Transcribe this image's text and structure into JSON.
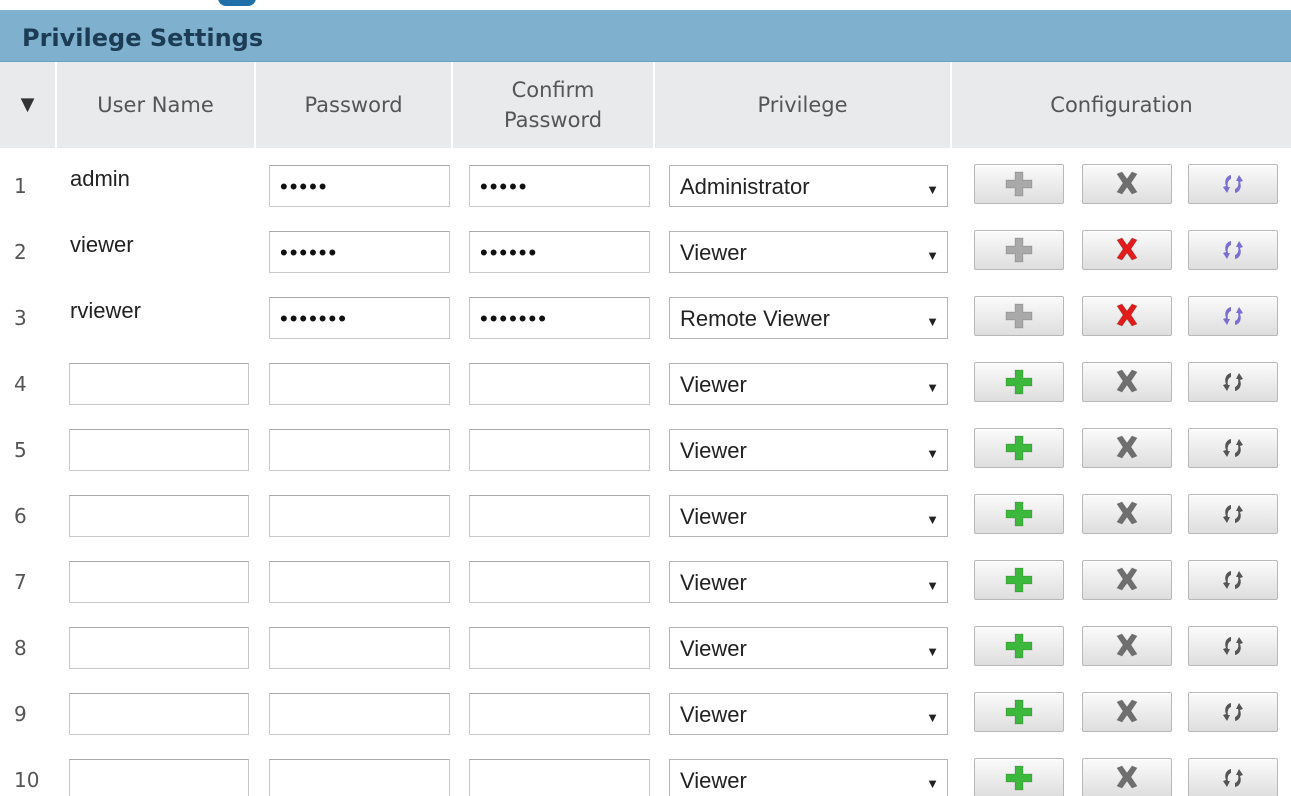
{
  "panel": {
    "title": "Privilege Settings"
  },
  "columns": {
    "sort_indicator": "▼",
    "user_name": "User Name",
    "password": "Password",
    "confirm_password_line1": "Confirm",
    "confirm_password_line2": "Password",
    "privilege": "Privilege",
    "configuration": "Configuration"
  },
  "rows": [
    {
      "num": "1",
      "user": "admin",
      "password": "•••••",
      "confirm": "•••••",
      "privilege": "Administrator",
      "existing": true,
      "delete_enabled": false
    },
    {
      "num": "2",
      "user": "viewer",
      "password": "••••••",
      "confirm": "••••••",
      "privilege": "Viewer",
      "existing": true,
      "delete_enabled": true
    },
    {
      "num": "3",
      "user": "rviewer",
      "password": "•••••••",
      "confirm": "•••••••",
      "privilege": "Remote Viewer",
      "existing": true,
      "delete_enabled": true
    },
    {
      "num": "4",
      "user": "",
      "password": "",
      "confirm": "",
      "privilege": "Viewer",
      "existing": false,
      "delete_enabled": false
    },
    {
      "num": "5",
      "user": "",
      "password": "",
      "confirm": "",
      "privilege": "Viewer",
      "existing": false,
      "delete_enabled": false
    },
    {
      "num": "6",
      "user": "",
      "password": "",
      "confirm": "",
      "privilege": "Viewer",
      "existing": false,
      "delete_enabled": false
    },
    {
      "num": "7",
      "user": "",
      "password": "",
      "confirm": "",
      "privilege": "Viewer",
      "existing": false,
      "delete_enabled": false
    },
    {
      "num": "8",
      "user": "",
      "password": "",
      "confirm": "",
      "privilege": "Viewer",
      "existing": false,
      "delete_enabled": false
    },
    {
      "num": "9",
      "user": "",
      "password": "",
      "confirm": "",
      "privilege": "Viewer",
      "existing": false,
      "delete_enabled": false
    },
    {
      "num": "10",
      "user": "",
      "password": "",
      "confirm": "",
      "privilege": "Viewer",
      "existing": false,
      "delete_enabled": false
    }
  ],
  "icons": {
    "add": "plus-icon",
    "delete": "x-icon",
    "update": "refresh-icon",
    "dropdown": "chevron-down-icon"
  },
  "colors": {
    "header_bg": "#7fb1cf",
    "header_text": "#1c3c55",
    "add_enabled": "#3cb83c",
    "add_disabled": "#a9a9a9",
    "delete_enabled": "#e21b1b",
    "delete_disabled": "#6f6f6f",
    "update_enabled": "#7b6fd6",
    "update_disabled": "#555555"
  }
}
